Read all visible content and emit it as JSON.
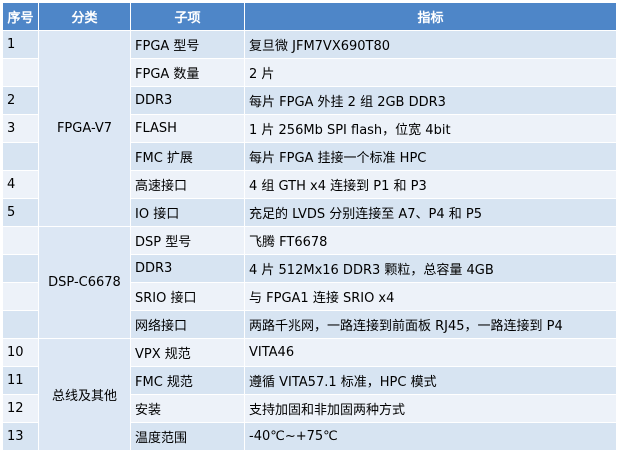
{
  "headers": {
    "no": "序号",
    "category": "分类",
    "item": "子项",
    "spec": "指标"
  },
  "categories": {
    "fpga": "FPGA-V7",
    "dsp": "DSP-C6678",
    "bus": "总线及其他"
  },
  "rows": [
    {
      "no": "1",
      "item": "FPGA 型号",
      "spec": "复旦微 JFM7VX690T80"
    },
    {
      "no": "",
      "item": "FPGA 数量",
      "spec": "2 片"
    },
    {
      "no": "2",
      "item": "DDR3",
      "spec": "每片 FPGA 外挂 2 组 2GB DDR3"
    },
    {
      "no": "3",
      "item": "FLASH",
      "spec": "1 片 256Mb SPI flash，位宽 4bit"
    },
    {
      "no": "",
      "item": "FMC 扩展",
      "spec": "每片 FPGA 挂接一个标准 HPC"
    },
    {
      "no": "4",
      "item": "高速接口",
      "spec": "4 组 GTH x4 连接到 P1 和 P3"
    },
    {
      "no": "5",
      "item": "IO 接口",
      "spec": "充足的 LVDS 分别连接至 A7、P4 和 P5"
    },
    {
      "no": "",
      "item": "DSP 型号",
      "spec": "飞腾 FT6678"
    },
    {
      "no": "",
      "item": "DDR3",
      "spec": "4 片 512Mx16 DDR3 颗粒，总容量 4GB"
    },
    {
      "no": "",
      "item": "SRIO 接口",
      "spec": "与 FPGA1 连接 SRIO x4"
    },
    {
      "no": "",
      "item": "网络接口",
      "spec": "两路千兆网，一路连接到前面板 RJ45，一路连接到 P4"
    },
    {
      "no": "10",
      "item": "VPX 规范",
      "spec": "VITA46"
    },
    {
      "no": "11",
      "item": "FMC 规范",
      "spec": "遵循 VITA57.1 标准，HPC 模式"
    },
    {
      "no": "12",
      "item": "安装",
      "spec": "支持加固和非加固两种方式"
    },
    {
      "no": "13",
      "item": "温度范围",
      "spec": "-40℃~+75℃"
    }
  ]
}
